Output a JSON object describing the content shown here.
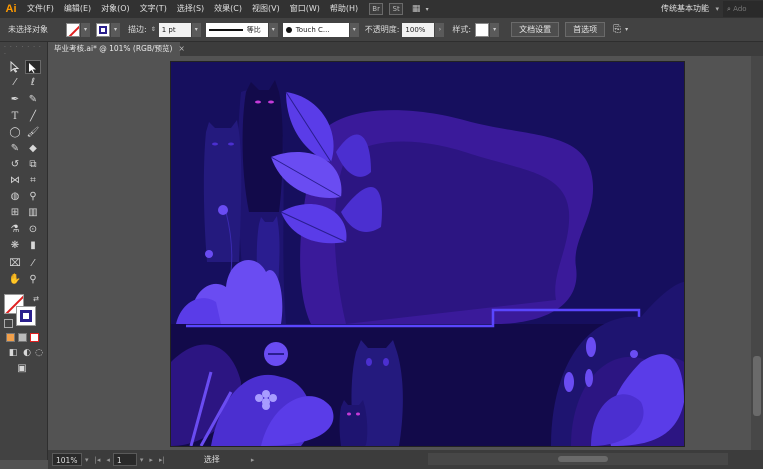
{
  "app": {
    "logo": "Ai"
  },
  "menu": {
    "items": [
      "文件(F)",
      "编辑(E)",
      "对象(O)",
      "文字(T)",
      "选择(S)",
      "效果(C)",
      "视图(V)",
      "窗口(W)",
      "帮助(H)"
    ],
    "badge_br": "Br",
    "badge_st": "St",
    "workspace": "传统基本功能",
    "search_placeholder": "Ado"
  },
  "control": {
    "selection_state": "未选择对象",
    "stroke_label": "描边:",
    "stroke_weight": "1 pt",
    "stroke_profile": "等比",
    "brush_name": "Touch C...",
    "opacity_label": "不透明度:",
    "opacity_value": "100%",
    "style_label": "样式:",
    "doc_setup_button": "文档设置",
    "preferences_button": "首选项"
  },
  "document": {
    "tab_title": "毕业考核.ai* @ 101% (RGB/预览)",
    "close_glyph": "×"
  },
  "status": {
    "zoom": "101%",
    "artboard_number": "1",
    "current_tool": "选择"
  },
  "colors": {
    "sky": "#160f5e",
    "backdrop_purple": "#3a1a9a",
    "violet": "#4b2fd0",
    "bright": "#6a4cf2",
    "accent_line": "#5a46ff",
    "cat_eyes": "#c43ad8"
  }
}
